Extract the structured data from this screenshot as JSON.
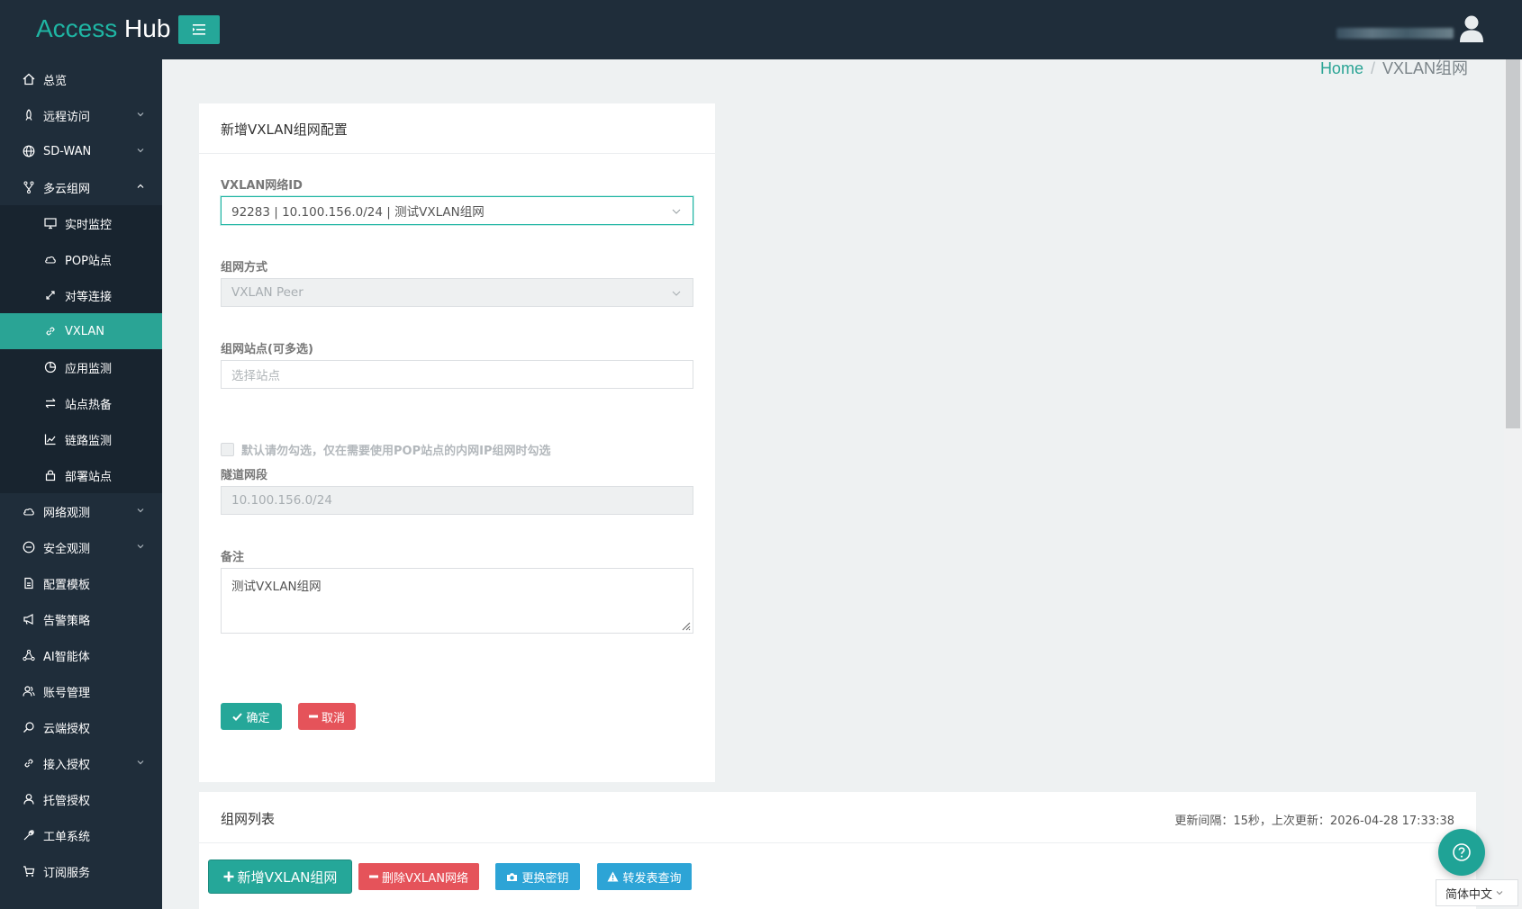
{
  "brand": {
    "part1": "Access ",
    "part2": "Hub"
  },
  "breadcrumb": {
    "home": "Home",
    "separator": "/",
    "current": "VXLAN组网"
  },
  "sidebar": {
    "items": [
      {
        "label": "总览",
        "icon": "home-icon"
      },
      {
        "label": "远程访问",
        "icon": "rocket-icon",
        "expandable": true
      },
      {
        "label": "SD-WAN",
        "icon": "globe-icon",
        "expandable": true
      },
      {
        "label": "多云组网",
        "icon": "fork-icon",
        "expanded": true
      },
      {
        "label": "网络观测",
        "icon": "cloud-icon",
        "expandable": true
      },
      {
        "label": "安全观测",
        "icon": "minus-circle-icon",
        "expandable": true
      },
      {
        "label": "配置模板",
        "icon": "file-icon"
      },
      {
        "label": "告警策略",
        "icon": "megaphone-icon"
      },
      {
        "label": "AI智能体",
        "icon": "nodes-icon"
      },
      {
        "label": "账号管理",
        "icon": "users-icon"
      },
      {
        "label": "云端授权",
        "icon": "key-search-icon"
      },
      {
        "label": "接入授权",
        "icon": "link-icon",
        "expandable": true
      },
      {
        "label": "托管授权",
        "icon": "user-icon"
      },
      {
        "label": "工单系统",
        "icon": "wrench-icon"
      },
      {
        "label": "订阅服务",
        "icon": "cart-icon"
      }
    ],
    "subitems": [
      {
        "label": "实时监控",
        "icon": "monitor-icon"
      },
      {
        "label": "POP站点",
        "icon": "cloud-icon"
      },
      {
        "label": "对等连接",
        "icon": "arrows-diagonal-icon"
      },
      {
        "label": "VXLAN",
        "icon": "link-icon",
        "active": true
      },
      {
        "label": "应用监测",
        "icon": "pie-icon"
      },
      {
        "label": "站点热备",
        "icon": "swap-icon"
      },
      {
        "label": "链路监测",
        "icon": "line-chart-icon"
      },
      {
        "label": "部署站点",
        "icon": "lock-icon"
      }
    ]
  },
  "form": {
    "title": "新增VXLAN组网配置",
    "vxlan_id_label": "VXLAN网络ID",
    "vxlan_id_value": "92283 | 10.100.156.0/24 | 测试VXLAN组网",
    "mode_label": "组网方式",
    "mode_value": "VXLAN Peer",
    "sites_label": "组网站点(可多选)",
    "sites_placeholder": "选择站点",
    "checkbox_label": "默认请勿勾选，仅在需要使用POP站点的内网IP组网时勾选",
    "tunnel_label": "隧道网段",
    "tunnel_value": "10.100.156.0/24",
    "remark_label": "备注",
    "remark_value": "测试VXLAN组网",
    "ok_label": "确定",
    "cancel_label": "取消"
  },
  "list": {
    "title": "组网列表",
    "refresh_info": "更新间隔：15秒，上次更新：2026-04-28 17:33:38",
    "add_label": "新增VXLAN组网",
    "delete_label": "删除VXLAN网络",
    "rekey_label": "更换密钥",
    "forward_label": "转发表查询"
  },
  "language": {
    "selected": "简体中文"
  },
  "colors": {
    "accent": "#25a799",
    "danger": "#e5535a",
    "info": "#2da4d6",
    "sidebar": "#1f2d3a"
  }
}
